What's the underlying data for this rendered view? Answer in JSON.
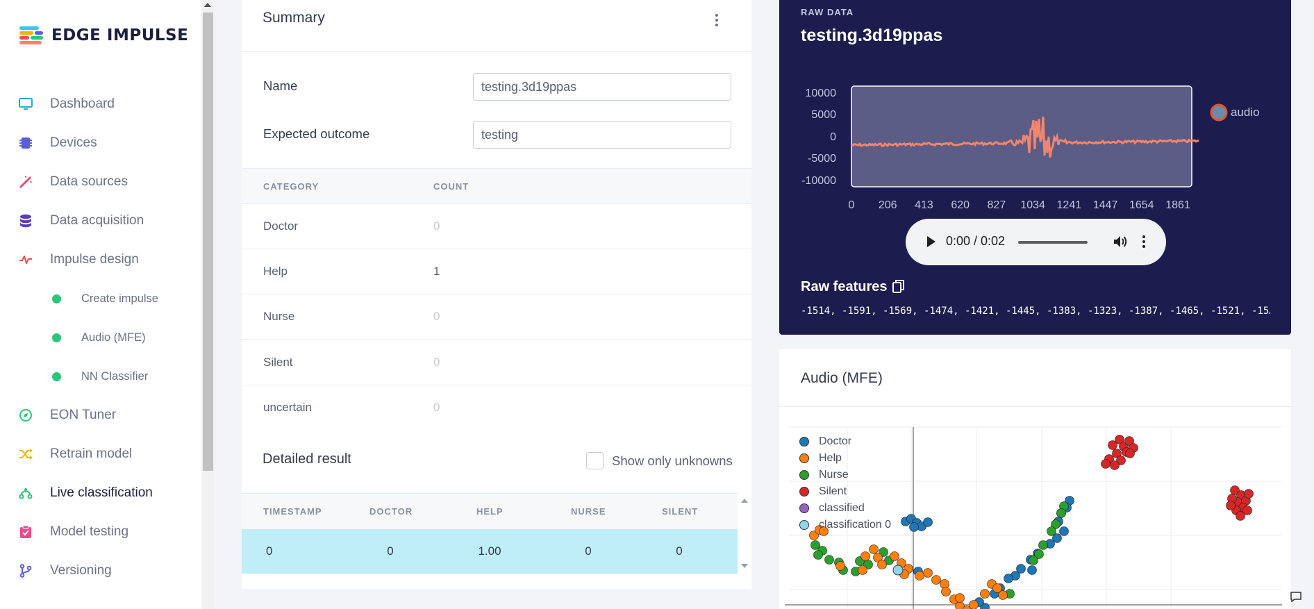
{
  "brand": {
    "name": "EDGE IMPULSE"
  },
  "sidebar": {
    "items": [
      {
        "label": "Dashboard",
        "icon": "monitor-icon",
        "color": "#2aa7d8"
      },
      {
        "label": "Devices",
        "icon": "chip-icon",
        "color": "#5b5fd6"
      },
      {
        "label": "Data sources",
        "icon": "magic-wand-icon",
        "color": "#e74b6b"
      },
      {
        "label": "Data acquisition",
        "icon": "database-icon",
        "color": "#5b3db8"
      },
      {
        "label": "Impulse design",
        "icon": "pulse-icon",
        "color": "#e74b4b"
      },
      {
        "label": "Create impulse",
        "icon": "status-dot-icon",
        "color": "#2ec47a"
      },
      {
        "label": "Audio (MFE)",
        "icon": "status-dot-icon",
        "color": "#2ec47a"
      },
      {
        "label": "NN Classifier",
        "icon": "status-dot-icon",
        "color": "#2ec47a"
      },
      {
        "label": "EON Tuner",
        "icon": "compass-icon",
        "color": "#2ec47a"
      },
      {
        "label": "Retrain model",
        "icon": "shuffle-icon",
        "color": "#f0b400"
      },
      {
        "label": "Live classification",
        "icon": "routes-icon",
        "color": "#2ec47a"
      },
      {
        "label": "Model testing",
        "icon": "clipboard-check-icon",
        "color": "#e74b8b"
      },
      {
        "label": "Versioning",
        "icon": "branch-icon",
        "color": "#5b5fd6"
      }
    ]
  },
  "summary": {
    "title": "Summary",
    "name_label": "Name",
    "name_value": "testing.3d19ppas",
    "outcome_label": "Expected outcome",
    "outcome_value": "testing",
    "col_category": "CATEGORY",
    "col_count": "COUNT",
    "categories": [
      {
        "name": "Doctor",
        "count": "0"
      },
      {
        "name": "Help",
        "count": "1"
      },
      {
        "name": "Nurse",
        "count": "0"
      },
      {
        "name": "Silent",
        "count": "0"
      },
      {
        "name": "uncertain",
        "count": "0"
      }
    ],
    "detail_title": "Detailed result",
    "show_unknowns_label": "Show only unknowns",
    "result_headers": [
      "TIMESTAMP",
      "DOCTOR",
      "HELP",
      "NURSE",
      "SILENT"
    ],
    "result_row": [
      "0",
      "0",
      "1.00",
      "0",
      "0"
    ]
  },
  "raw_data": {
    "kicker": "RAW DATA",
    "filename": "testing.3d19ppas",
    "y_ticks": [
      "10000",
      "5000",
      "0",
      "-5000",
      "-10000"
    ],
    "x_ticks": [
      "0",
      "206",
      "413",
      "620",
      "827",
      "1034",
      "1241",
      "1447",
      "1654",
      "1861"
    ],
    "legend": "audio",
    "wave_color": "#f4856b",
    "player_time": "0:00 / 0:02",
    "features_title": "Raw features",
    "features_text": "-1514, -1591, -1569, -1474, -1421, -1445, -1383, -1323, -1387, -1465, -1521, -15…"
  },
  "mfe": {
    "title": "Audio (MFE)",
    "legend": [
      {
        "label": "Doctor",
        "color": "#1f77b4"
      },
      {
        "label": "Help",
        "color": "#ff7f0e"
      },
      {
        "label": "Nurse",
        "color": "#2ca02c"
      },
      {
        "label": "Silent",
        "color": "#d62728"
      },
      {
        "label": "classified",
        "color": "#9467bd"
      },
      {
        "label": "classification 0",
        "color": "#8fd7ef"
      }
    ]
  }
}
